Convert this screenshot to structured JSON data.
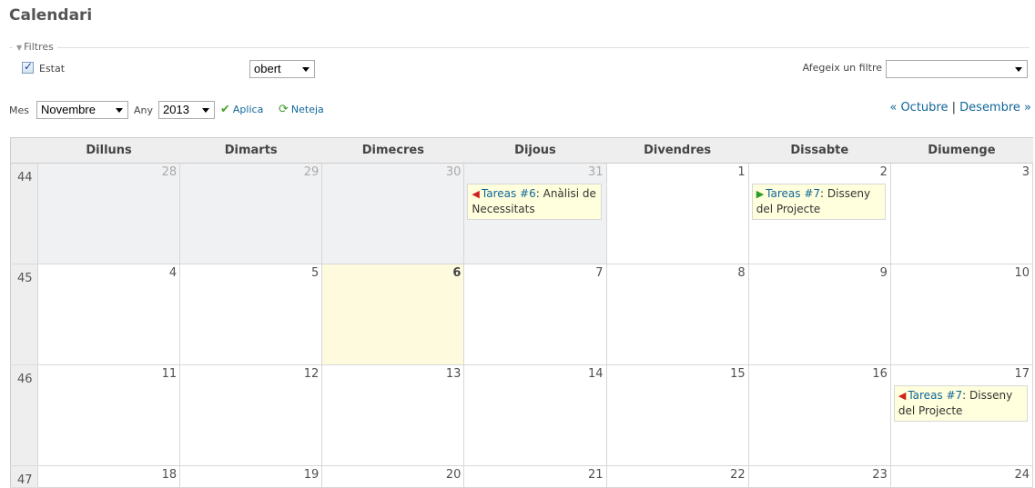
{
  "page": {
    "title": "Calendari"
  },
  "filters": {
    "legend": "Filtres",
    "estat_label": "Estat",
    "estat_value": "obert",
    "add_filter_label": "Afegeix un filtre",
    "add_filter_value": ""
  },
  "period": {
    "month_label": "Mes",
    "month_value": "Novembre",
    "year_label": "Any",
    "year_value": "2013",
    "apply_label": "Aplica",
    "clear_label": "Neteja"
  },
  "nav": {
    "prev": "« Octubre",
    "separator": "|",
    "next": "Desembre »"
  },
  "calendar": {
    "weekdays": [
      "Dilluns",
      "Dimarts",
      "Dimecres",
      "Dijous",
      "Divendres",
      "Dissabte",
      "Diumenge"
    ],
    "weeks": [
      {
        "number": "44",
        "days": [
          "28",
          "29",
          "30",
          "31",
          "1",
          "2",
          "3"
        ]
      },
      {
        "number": "45",
        "days": [
          "4",
          "5",
          "6",
          "7",
          "8",
          "9",
          "10"
        ]
      },
      {
        "number": "46",
        "days": [
          "11",
          "12",
          "13",
          "14",
          "15",
          "16",
          "17"
        ]
      },
      {
        "number": "47",
        "days": [
          "18",
          "19",
          "20",
          "21",
          "22",
          "23",
          "24"
        ]
      }
    ],
    "issues": {
      "w0d3": {
        "tracker": "Tareas #6",
        "subject": ": Anàlisi de Necessitats",
        "kind": "end"
      },
      "w0d5": {
        "tracker": "Tareas #7",
        "subject": ": Disseny del Projecte",
        "kind": "start"
      },
      "w2d6": {
        "tracker": "Tareas #7",
        "subject": ": Disseny del Projecte",
        "kind": "end"
      }
    }
  },
  "colors": {
    "link": "#116699",
    "today_bg": "#fdfadd",
    "other_month_bg": "#f0f1f3",
    "issue_bg": "#ffffdd",
    "start_arrow": "#2a9a2a",
    "end_arrow": "#d02020"
  },
  "icons": {
    "apply": "check-icon",
    "clear": "reload-icon",
    "start": "arrow-right-icon",
    "end": "arrow-left-icon"
  }
}
